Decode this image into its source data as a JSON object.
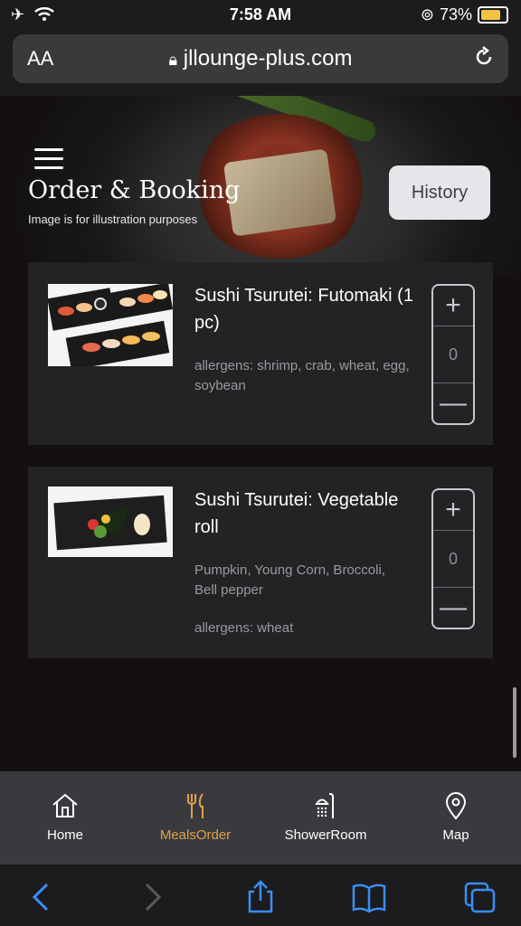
{
  "status": {
    "time": "7:58 AM",
    "battery": "73%",
    "battery_level": 0.73
  },
  "browser": {
    "text_size": "AA",
    "url": "jllounge-plus.com"
  },
  "hero": {
    "title": "Order & Booking",
    "subtitle": "Image is for illustration purposes",
    "history_button": "History"
  },
  "items": [
    {
      "name": "Sushi Tsurutei: Futomaki (1 pc)",
      "description": "",
      "allergens": "allergens: shrimp, crab, wheat, egg, soybean",
      "quantity": "0"
    },
    {
      "name": "Sushi Tsurutei: Vegetable roll",
      "description": "Pumpkin, Young Corn, Broccoli, Bell pepper",
      "allergens": "allergens: wheat",
      "quantity": "0"
    }
  ],
  "tabs": [
    {
      "label": "Home",
      "icon": "home-icon"
    },
    {
      "label": "MealsOrder",
      "icon": "fork-knife-icon"
    },
    {
      "label": "ShowerRoom",
      "icon": "shower-icon"
    },
    {
      "label": "Map",
      "icon": "map-pin-icon"
    }
  ],
  "colors": {
    "accent": "#e0a04a",
    "safari_blue": "#3a8ef6"
  }
}
